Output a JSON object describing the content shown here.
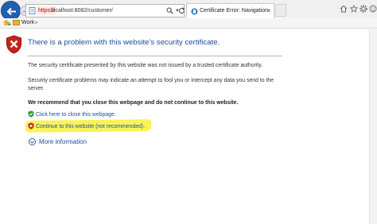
{
  "browser": {
    "url_scheme": "https://",
    "url_rest": "localhost:8082/customer/",
    "tab_title": "Certificate Error: Navigation...",
    "tab_close": "×",
    "favorites_bar": {
      "folder_label": "Work",
      "chevron": "»"
    },
    "icons": [
      "back-arrow-icon",
      "forward-arrow-icon",
      "certificate-error-icon",
      "search-icon",
      "refresh-icon",
      "home-icon",
      "star-icon",
      "gear-icon",
      "smiley-icon"
    ]
  },
  "page": {
    "title": "There is a problem with this website's security certificate.",
    "para1": "The security certificate presented by this website was not issued by a trusted certificate authority.",
    "para2": "Security certificate problems may indicate an attempt to fool you or intercept any data you send to the server.",
    "recommend": "We recommend that you close this webpage and do not continue to this website.",
    "close_link": "Click here to close this webpage.",
    "continue_link": "Continue to this website (not recommended).",
    "more_info": "More information",
    "highlight_color": "#f7f24a",
    "title_color": "#1f4d95",
    "link_color": "#1f4db0"
  }
}
